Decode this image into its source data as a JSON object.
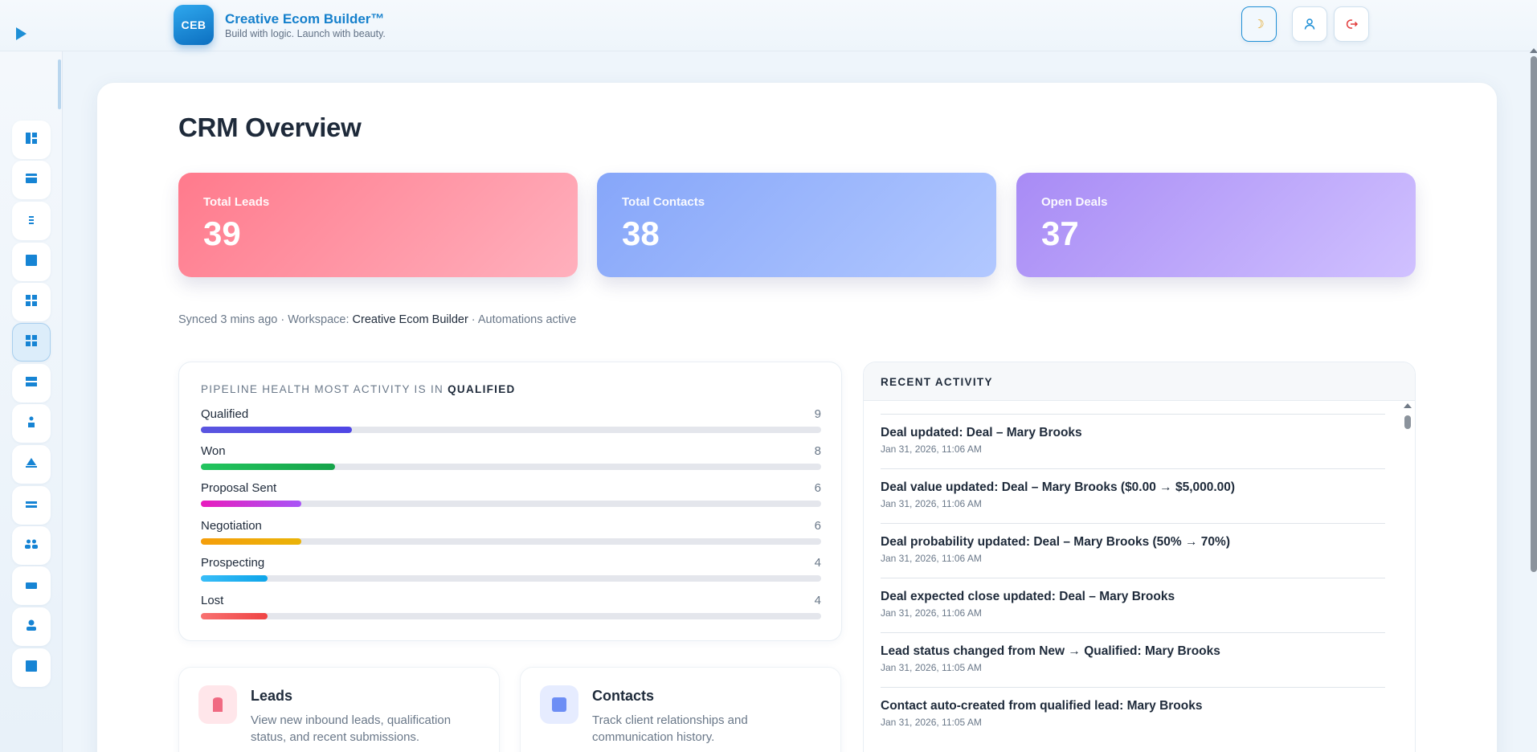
{
  "app": {
    "logo_text": "CEB",
    "title": "Creative Ecom Builder™",
    "tagline": "Build with logic. Launch with beauty."
  },
  "header_buttons": [
    {
      "name": "theme-toggle",
      "icon": "moon-icon"
    },
    {
      "name": "profile",
      "icon": "user-icon"
    },
    {
      "name": "logout",
      "icon": "logout-icon"
    }
  ],
  "sidebar": {
    "items": [
      {
        "icon": "dashboard-icon"
      },
      {
        "icon": "card-icon"
      },
      {
        "icon": "list-icon"
      },
      {
        "icon": "square-icon"
      },
      {
        "icon": "grid-icon"
      },
      {
        "icon": "grid-icon",
        "active": true
      },
      {
        "icon": "rows-icon"
      },
      {
        "icon": "shapes-icon"
      },
      {
        "icon": "triangle-icon"
      },
      {
        "icon": "lines-icon"
      },
      {
        "icon": "users-icon"
      },
      {
        "icon": "bar-icon"
      },
      {
        "icon": "person-icon"
      },
      {
        "icon": "square-icon"
      }
    ]
  },
  "page": {
    "title": "CRM Overview"
  },
  "stats": {
    "leads": {
      "label": "Total Leads",
      "value": "39"
    },
    "contacts": {
      "label": "Total Contacts",
      "value": "38"
    },
    "deals": {
      "label": "Open Deals",
      "value": "37"
    }
  },
  "sync": {
    "prefix": "Synced 3 mins ago · Workspace: ",
    "workspace": "Creative Ecom Builder",
    "suffix": " · Automations active"
  },
  "pipeline": {
    "heading": "PIPELINE HEALTH MOST ACTIVITY IS IN ",
    "highlight": "QUALIFIED",
    "max": 37,
    "stages": [
      {
        "name": "Qualified",
        "count": "9",
        "value": 9,
        "color": "#5a55e0",
        "color2": "#4f46e5"
      },
      {
        "name": "Won",
        "count": "8",
        "value": 8,
        "color": "#22c55e",
        "color2": "#16a34a"
      },
      {
        "name": "Proposal Sent",
        "count": "6",
        "value": 6,
        "color": "#e81bbd",
        "color2": "#a855f7"
      },
      {
        "name": "Negotiation",
        "count": "6",
        "value": 6,
        "color": "#f59e0b",
        "color2": "#eab308"
      },
      {
        "name": "Prospecting",
        "count": "4",
        "value": 4,
        "color": "#38bdf8",
        "color2": "#0ea5e9"
      },
      {
        "name": "Lost",
        "count": "4",
        "value": 4,
        "color": "#f87171",
        "color2": "#ef4444"
      }
    ]
  },
  "activity": {
    "title": "RECENT ACTIVITY",
    "items": [
      {
        "text": "Deal updated: Deal – Mary Brooks",
        "time": "Jan 31, 2026, 11:06 AM"
      },
      {
        "text": "Deal value updated: Deal – Mary Brooks ($0.00 → $5,000.00)",
        "time": "Jan 31, 2026, 11:06 AM"
      },
      {
        "text": "Deal probability updated: Deal – Mary Brooks (50% → 70%)",
        "time": "Jan 31, 2026, 11:06 AM"
      },
      {
        "text": "Deal expected close updated: Deal – Mary Brooks",
        "time": "Jan 31, 2026, 11:06 AM"
      },
      {
        "text": "Lead status changed from New → Qualified: Mary Brooks",
        "time": "Jan 31, 2026, 11:05 AM"
      },
      {
        "text": "Contact auto-created from qualified lead: Mary Brooks",
        "time": "Jan 31, 2026, 11:05 AM"
      }
    ]
  },
  "modules": {
    "leads": {
      "title": "Leads",
      "desc": "View new inbound leads, qualification status, and recent submissions.",
      "icon": "lead-icon",
      "color": "#f06a82"
    },
    "contacts": {
      "title": "Contacts",
      "desc": "Track client relationships and communication history.",
      "icon": "contact-icon",
      "color": "#6d8ef5"
    }
  }
}
